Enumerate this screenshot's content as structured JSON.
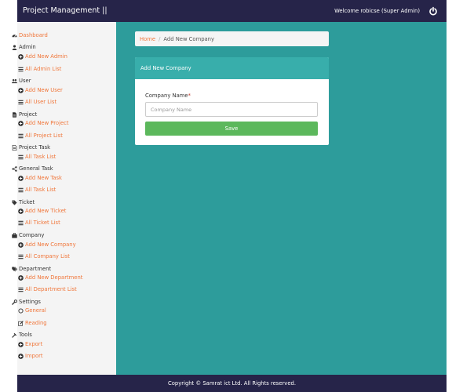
{
  "header": {
    "brand": "Project Management ||",
    "welcome": "Welcome robicse (Super Admin)",
    "logout_icon": "power-icon"
  },
  "sidebar": {
    "dashboard": "Dashboard",
    "admin": {
      "label": "Admin",
      "add": "Add New Admin",
      "list": "All Admin List"
    },
    "user": {
      "label": "User",
      "add": "Add New User",
      "list": "All User List"
    },
    "project": {
      "label": "Project",
      "add": "Add New Project",
      "list": "All Project List"
    },
    "project_task": {
      "label": "Project Task",
      "list": "All Task List"
    },
    "general_task": {
      "label": "General Task",
      "add": "Add New Task",
      "list": "All Task List"
    },
    "ticket": {
      "label": "Ticket",
      "add": "Add New Ticket",
      "list": "All Ticket List"
    },
    "company": {
      "label": "Company",
      "add": "Add New Company",
      "list": "All Company List"
    },
    "department": {
      "label": "Department",
      "add": "Add New Department",
      "list": "All Department List"
    },
    "settings": {
      "label": "Settings",
      "general": "General",
      "reading": "Reading"
    },
    "tools": {
      "label": "Tools",
      "export": "Export",
      "import": "Import"
    }
  },
  "breadcrumb": {
    "home": "Home",
    "separator": "/",
    "current": "Add New Company"
  },
  "form": {
    "title": "Add New Company",
    "field_label": "Company Name",
    "required_mark": "*",
    "placeholder": "Company Name",
    "value": "",
    "save_label": "Save"
  },
  "footer": {
    "text": "Copyright © Samrat ict Ltd. All Rights reserved."
  },
  "colors": {
    "topbar": "#262449",
    "content_bg": "#2d9c9b",
    "panel_head": "#38aeab",
    "link": "#f0763a",
    "save_button": "#5cb85c"
  }
}
